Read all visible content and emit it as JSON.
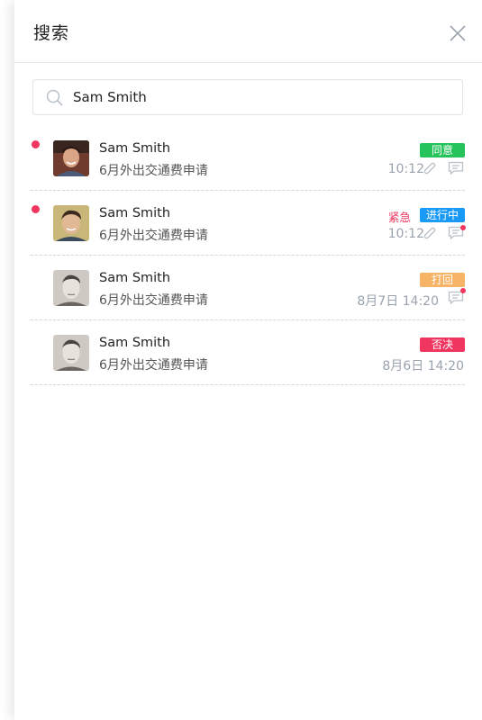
{
  "header": {
    "title": "搜索"
  },
  "search": {
    "value": "Sam Smith"
  },
  "colors": {
    "unread_dot": "#f0355e",
    "status_agree": "#26c35c",
    "status_progress": "#1a9af7",
    "status_returned": "#f7b466",
    "status_rejected": "#f0355e",
    "muted_text": "#9aa3ad"
  },
  "items": [
    {
      "name": "Sam Smith",
      "subject": "6月外出交通费申请",
      "status": "同意",
      "status_color": "#26c35c",
      "urgent": "",
      "time": "10:12",
      "unread": true,
      "attachment": true,
      "comment_dot": false,
      "avatar": "avatar-1"
    },
    {
      "name": "Sam Smith",
      "subject": "6月外出交通费申请",
      "status": "进行中",
      "status_color": "#1a9af7",
      "urgent": "紧急",
      "time": "10:12",
      "unread": true,
      "attachment": true,
      "comment_dot": true,
      "avatar": "avatar-2"
    },
    {
      "name": "Sam Smith",
      "subject": "6月外出交通费申请",
      "status": "打回",
      "status_color": "#f7b466",
      "urgent": "",
      "time": "8月7日 14:20",
      "unread": false,
      "attachment": false,
      "comment_dot": true,
      "avatar": "avatar-3"
    },
    {
      "name": "Sam Smith",
      "subject": "6月外出交通费申请",
      "status": "否决",
      "status_color": "#f0355e",
      "urgent": "",
      "time": "8月6日 14:20",
      "unread": false,
      "attachment": false,
      "comment_dot": false,
      "avatar": "avatar-3"
    }
  ]
}
